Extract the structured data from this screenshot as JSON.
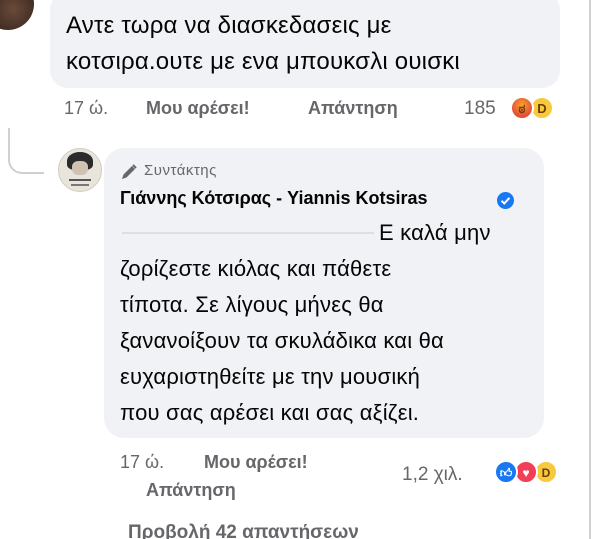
{
  "comment1": {
    "text_lines": [
      "Αντε τωρα να διασκεδασεις με",
      "κοτσιρα.ουτε με ενα μπουκσλι ουισκι"
    ],
    "time": "17 ώ.",
    "like_label": "Μου αρέσει!",
    "reply_label": "Απάντηση",
    "reaction_count": "185",
    "reactions": [
      "angry-icon",
      "haha-icon"
    ]
  },
  "reply": {
    "badge_label": "Συντάκτης",
    "author_name": "Γιάννης Κότσιρας - Yiannis Kotsiras",
    "text_lines": [
      "Ε καλά μην",
      "ζορίζεστε κιόλας και πάθετε",
      "τίποτα. Σε λίγους μήνες θα",
      "ξανανοίξουν τα σκυλάδικα και θα",
      "ευχαριστηθείτε με την μουσική",
      "που σας αρέσει και σας αξίζει."
    ],
    "time": "17 ώ.",
    "like_label": "Μου αρέσει!",
    "reply_label": "Απάντηση",
    "reaction_count": "1,2 χιλ.",
    "reactions": [
      "like-icon",
      "love-icon",
      "haha-icon"
    ]
  },
  "more_replies_label": "Προβολή 42 απαντήσεων"
}
